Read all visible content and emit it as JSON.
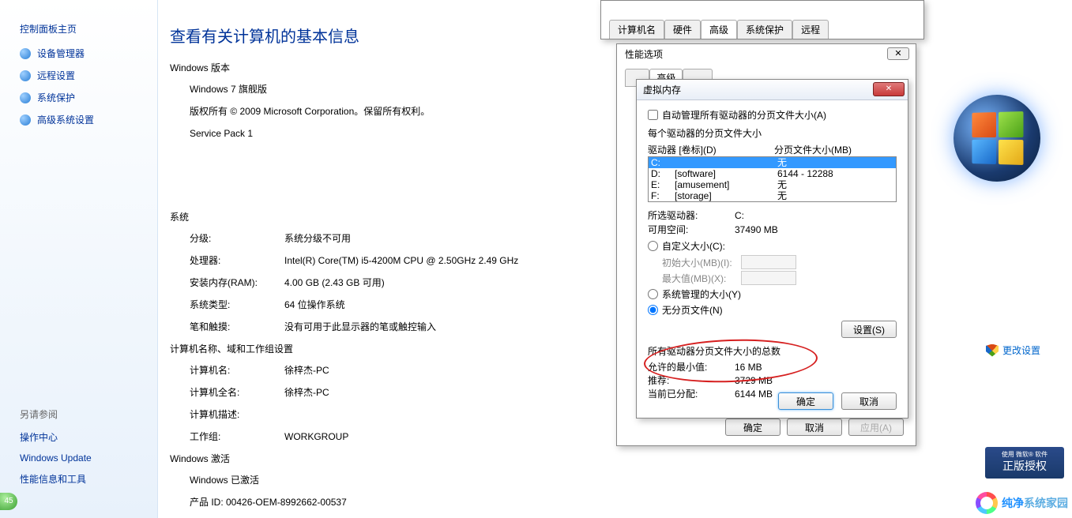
{
  "sidebar": {
    "title": "控制面板主页",
    "links": [
      "设备管理器",
      "远程设置",
      "系统保护",
      "高级系统设置"
    ],
    "footer_hdr": "另请参阅",
    "footer_links": [
      "操作中心",
      "Windows Update",
      "性能信息和工具"
    ]
  },
  "main": {
    "title": "查看有关计算机的基本信息",
    "edition_hdr": "Windows 版本",
    "edition": "Windows 7 旗舰版",
    "copyright": "版权所有 © 2009 Microsoft Corporation。保留所有权利。",
    "sp": "Service Pack 1",
    "system_hdr": "系统",
    "rating_lbl": "分级:",
    "rating_val": "系统分级不可用",
    "cpu_lbl": "处理器:",
    "cpu_val": "Intel(R) Core(TM) i5-4200M CPU @ 2.50GHz   2.49 GHz",
    "ram_lbl": "安装内存(RAM):",
    "ram_val": "4.00 GB (2.43 GB 可用)",
    "type_lbl": "系统类型:",
    "type_val": "64 位操作系统",
    "pen_lbl": "笔和触摸:",
    "pen_val": "没有可用于此显示器的笔或触控输入",
    "name_hdr": "计算机名称、域和工作组设置",
    "cname_lbl": "计算机名:",
    "cname_val": "徐梓杰-PC",
    "cfull_lbl": "计算机全名:",
    "cfull_val": "徐梓杰-PC",
    "cdesc_lbl": "计算机描述:",
    "cdesc_val": "",
    "wg_lbl": "工作组:",
    "wg_val": "WORKGROUP",
    "act_hdr": "Windows 激活",
    "act_status": "Windows 已激活",
    "pid": "产品 ID: 00426-OEM-8992662-00537",
    "change_settings": "更改设置"
  },
  "sysattr": {
    "tabs": [
      "计算机名",
      "硬件",
      "高级",
      "系统保护",
      "远程"
    ]
  },
  "perfopt": {
    "title": "性能选项",
    "tab_adv": "高级",
    "ok": "确定",
    "cancel": "取消",
    "apply": "应用(A)"
  },
  "vmem": {
    "title": "虚拟内存",
    "auto": "自动管理所有驱动器的分页文件大小(A)",
    "each_hdr": "每个驱动器的分页文件大小",
    "drv_hdr": "驱动器 [卷标](D)",
    "size_hdr": "分页文件大小(MB)",
    "drives": [
      {
        "letter": "C:",
        "label": "",
        "size": "无"
      },
      {
        "letter": "D:",
        "label": "[software]",
        "size": "6144 - 12288"
      },
      {
        "letter": "E:",
        "label": "[amusement]",
        "size": "无"
      },
      {
        "letter": "F:",
        "label": "[storage]",
        "size": "无"
      }
    ],
    "sel_drv_lbl": "所选驱动器:",
    "sel_drv_val": "C:",
    "free_lbl": "可用空间:",
    "free_val": "37490 MB",
    "custom": "自定义大小(C):",
    "init_lbl": "初始大小(MB)(I):",
    "max_lbl": "最大值(MB)(X):",
    "sysman": "系统管理的大小(Y)",
    "nopage": "无分页文件(N)",
    "setbtn": "设置(S)",
    "total_hdr": "所有驱动器分页文件大小的总数",
    "min_lbl": "允许的最小值:",
    "min_val": "16 MB",
    "rec_lbl": "推荐:",
    "rec_val": "3729 MB",
    "cur_lbl": "当前已分配:",
    "cur_val": "6144 MB",
    "ok": "确定",
    "cancel": "取消"
  },
  "genuine": {
    "top": "使用 微软® 软件",
    "mid": "正版授权"
  },
  "watermark": {
    "a": "纯净",
    "b": "系统家园"
  },
  "badge45": "45"
}
